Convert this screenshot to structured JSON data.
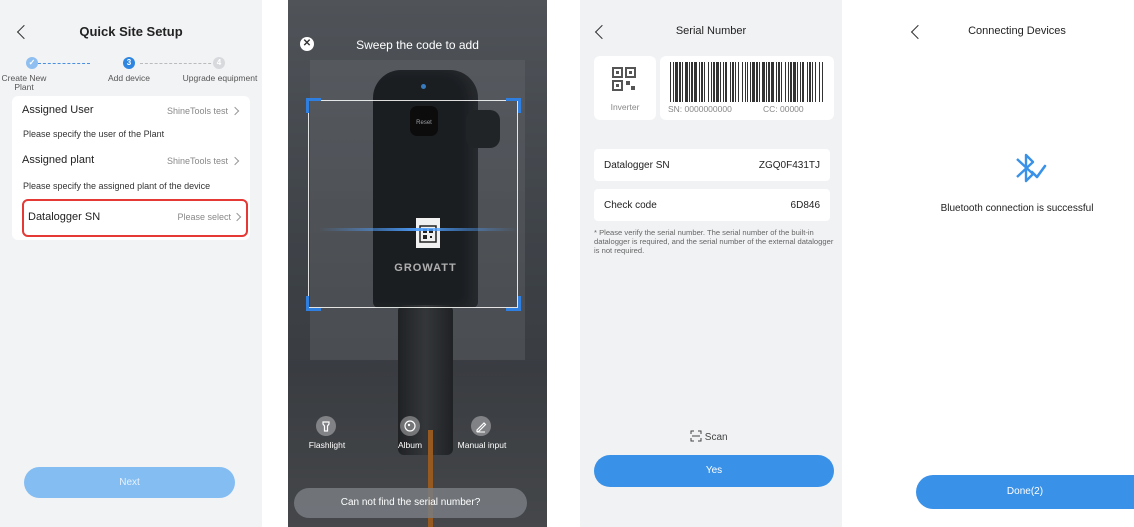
{
  "panel1": {
    "title": "Quick Site Setup",
    "steps": [
      {
        "number": "✓",
        "label": "Create New Plant",
        "state": "done"
      },
      {
        "number": "3",
        "label": "Add device",
        "state": "active"
      },
      {
        "number": "4",
        "label": "Upgrade equipment",
        "state": "pending"
      }
    ],
    "rows": [
      {
        "title": "Assigned User",
        "value": "ShineTools test",
        "hint": "Please specify the user of the Plant"
      },
      {
        "title": "Assigned plant",
        "value": "ShineTools test",
        "hint": "Please specify the assigned plant of the device"
      },
      {
        "title": "Datalogger SN",
        "value": "Please select"
      }
    ],
    "next_label": "Next",
    "highlight_color": "#e53935"
  },
  "panel2": {
    "title": "Sweep the code to add",
    "tools": [
      "Flashlight",
      "Album",
      "Manual input"
    ],
    "cant_find": "Can not find the serial number?",
    "device_brand": "GROWATT",
    "device_button": "Reset"
  },
  "panel3": {
    "title": "Serial Number",
    "device_type": "Inverter",
    "barcode_sn": "SN: 0000000000",
    "barcode_cc": "CC: 00000",
    "datalogger_label": "Datalogger SN",
    "datalogger_value": "ZGQ0F431TJ",
    "check_label": "Check code",
    "check_value": "6D846",
    "note": "* Please verify the serial number. The serial number of the built-in datalogger is required, and the serial number of the external datalogger is not required.",
    "scan_label": "Scan",
    "yes_label": "Yes"
  },
  "panel4": {
    "title": "Connecting Devices",
    "status": "Bluetooth connection is successful",
    "done_label": "Done(2)"
  },
  "colors": {
    "accent": "#3a92e8",
    "accent_light": "#84bdf2"
  }
}
